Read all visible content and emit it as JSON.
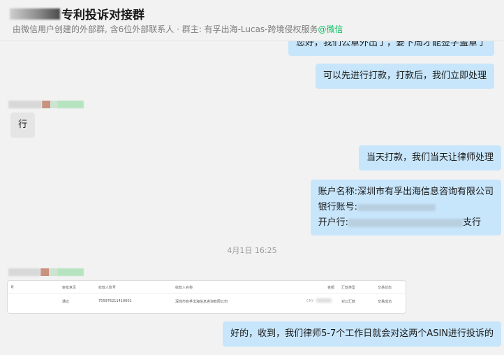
{
  "header": {
    "title": "专利投诉对接群",
    "subtitle": "由微信用户创建的外部群, 含6位外部联系人 · 群主: 有孚出海-Lucas-跨境侵权服务",
    "subtitle_wechat": "@微信"
  },
  "messages": {
    "m0": "您好，我们公章外出了，要下周才能签字盖章了",
    "m1": "可以先进行打款，打款后，我们立即处理",
    "m2": "行",
    "m3": "当天打款，我们当天让律师处理",
    "m4_line1": "账户名称:深圳市有孚出海信息咨询有限公司",
    "m4_line2_label": "银行账号:",
    "m4_line2_partial": "755976211410001",
    "m4_line3_label": "开户行:",
    "m4_line3_suffix": "支行",
    "timestamp": "4月1日 16:25",
    "m6": "好的，收到，我们律师5-7个工作日就会对这两个ASIN进行投诉的"
  },
  "receipt": {
    "headers": [
      "号",
      "审批意见",
      "收款人账号",
      "收款人名称",
      "金额",
      "汇款类型",
      "交易状态"
    ],
    "row": [
      "",
      "通过",
      "755976211410001",
      "深圳市有孚出海信息咨询有限公司",
      "CNY",
      "对公汇款",
      "交易成功"
    ]
  },
  "colors": {
    "self_bubble": "#c8e6fb",
    "other_bubble": "#e5e5e5",
    "background": "#f2f2f2",
    "wechat_green": "#07c160"
  }
}
